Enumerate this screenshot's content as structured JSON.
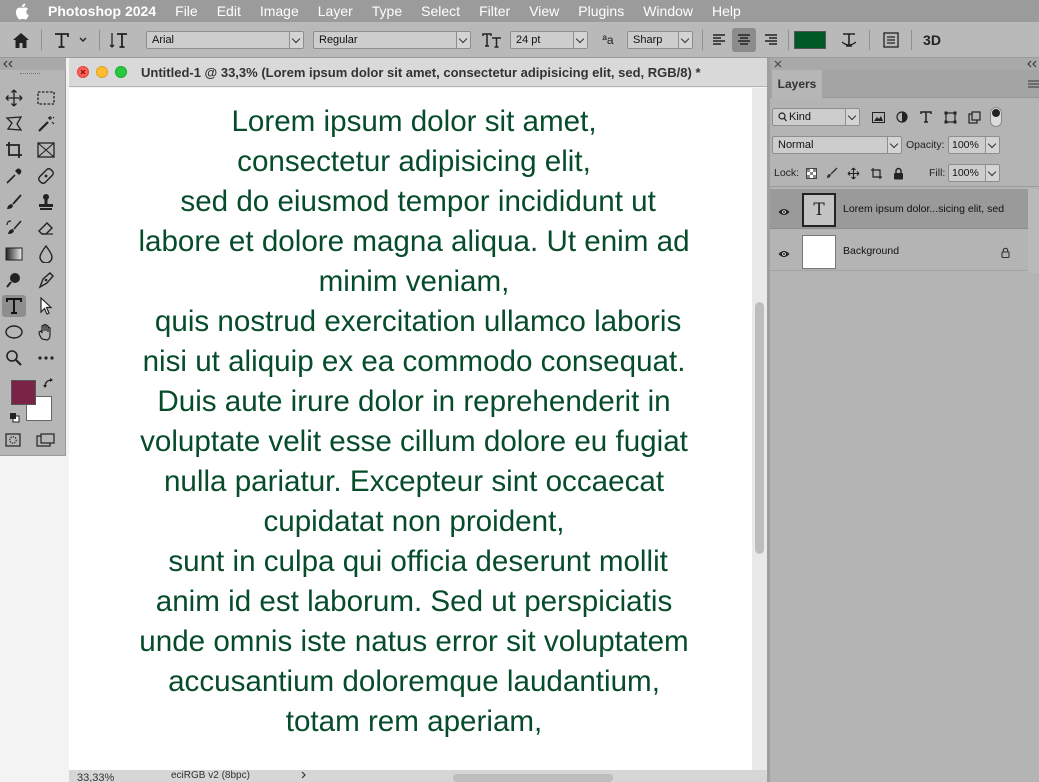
{
  "menubar": {
    "app_name": "Photoshop 2024",
    "items": [
      "File",
      "Edit",
      "Image",
      "Layer",
      "Type",
      "Select",
      "Filter",
      "View",
      "Plugins",
      "Window",
      "Help"
    ]
  },
  "options": {
    "font_family": "Arial",
    "font_style": "Regular",
    "font_size": "24 pt",
    "antialias": "Sharp",
    "aa_icon_text": "ªa",
    "threed_label": "3D",
    "text_color": "#005a26"
  },
  "document": {
    "title": "Untitled-1 @ 33,3% (Lorem ipsum dolor sit amet,  consectetur adipisicing elit,  sed, RGB/8) *",
    "zoom": "33,33%",
    "profile": "eciRGB v2 (8bpc)",
    "text_lines": [
      "Lorem ipsum dolor sit amet,",
      "consectetur adipisicing elit,",
      " sed do eiusmod tempor incididunt ut",
      "labore et dolore magna aliqua. Ut enim ad",
      "minim veniam,",
      " quis nostrud exercitation ullamco laboris",
      "nisi ut aliquip ex ea commodo consequat.",
      "Duis aute irure dolor in reprehenderit in",
      "voluptate velit esse cillum dolore eu fugiat",
      "nulla pariatur. Excepteur sint occaecat",
      "cupidatat non proident,",
      " sunt in culpa qui officia deserunt mollit",
      "anim id est laborum. Sed ut perspiciatis",
      "unde omnis iste natus error sit voluptatem",
      "accusantium doloremque laudantium,",
      "totam rem aperiam,"
    ],
    "text_color": "#064c2a"
  },
  "toolbar": {
    "foreground_color": "#7b2346",
    "background_color": "#ffffff"
  },
  "layers_panel": {
    "tab": "Layers",
    "filter_kind": "Kind",
    "blend_mode": "Normal",
    "opacity_label": "Opacity:",
    "opacity_value": "100%",
    "lock_label": "Lock:",
    "fill_label": "Fill:",
    "fill_value": "100%",
    "layers": [
      {
        "name": "Lorem ipsum dolor...sicing elit,  sed",
        "thumb": "T",
        "selected": true
      },
      {
        "name": "Background",
        "locked": true
      }
    ]
  }
}
